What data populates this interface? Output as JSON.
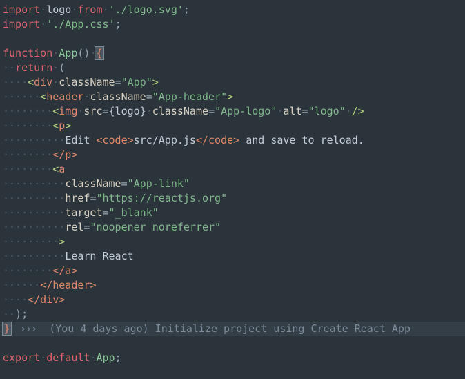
{
  "editor": {
    "background_color": "#2b343b",
    "foreground_color": "#c3ccd4",
    "font_size_px": 15,
    "line_height_px": 21,
    "colors": {
      "keyword": "#e0616e",
      "function_name": "#8cc79a",
      "string": "#7fb78a",
      "jsx_tag": "#e0876a",
      "jsx_bracket": "#b6d07a",
      "attribute": "#d6cfc0",
      "punctuation": "#9aa7b0",
      "indent_guide": "#4d5a63",
      "blame_text": "#7e8b99",
      "blame_background": "#333e47",
      "bracket_highlight_bg": "#4b5861",
      "bracket_highlight_border": "#7d8b94"
    }
  },
  "lines": {
    "l1": {
      "import_kw": "import",
      "binding": "logo",
      "from_kw": "from",
      "module": "'./logo.svg'",
      "semi": ";"
    },
    "l2": {
      "import_kw": "import",
      "module": "'./App.css'",
      "semi": ";"
    },
    "l4": {
      "function_kw": "function",
      "name": "App",
      "parens": "()",
      "brace": "{"
    },
    "l5": {
      "return_kw": "return",
      "paren": "("
    },
    "l6": {
      "open": "<",
      "tag": "div",
      "attr": "className",
      "eq": "=",
      "value": "\"App\"",
      "close": ">"
    },
    "l7": {
      "open": "<",
      "tag": "header",
      "attr": "className",
      "eq": "=",
      "value": "\"App-header\"",
      "close": ">"
    },
    "l8": {
      "open": "<",
      "tag": "img",
      "attr_src": "src",
      "eq1": "=",
      "expr": "{logo}",
      "attr_class": "className",
      "eq2": "=",
      "value_class": "\"App-logo\"",
      "attr_alt": "alt",
      "eq3": "=",
      "value_alt": "\"logo\"",
      "selfclose": "/>"
    },
    "l9": {
      "open": "<",
      "tag": "p",
      "close": ">"
    },
    "l10": {
      "text_before": "Edit ",
      "code_open": "<code>",
      "code_text": "src/App.js",
      "code_close": "</code>",
      "text_after": " and save to reload."
    },
    "l11": {
      "close_tag": "</p>"
    },
    "l12": {
      "open": "<",
      "tag": "a"
    },
    "l13": {
      "attr": "className",
      "eq": "=",
      "value": "\"App-link\""
    },
    "l14": {
      "attr": "href",
      "eq": "=",
      "value": "\"https://reactjs.org\""
    },
    "l15": {
      "attr": "target",
      "eq": "=",
      "value": "\"_blank\""
    },
    "l16": {
      "attr": "rel",
      "eq": "=",
      "value": "\"noopener noreferrer\""
    },
    "l17": {
      "close": ">"
    },
    "l18": {
      "text": "Learn React"
    },
    "l19": {
      "close_tag": "</a>"
    },
    "l20": {
      "close_tag": "</header>"
    },
    "l21": {
      "close_tag": "</div>"
    },
    "l22": {
      "paren": ")",
      "semi": ";"
    },
    "l23_blame": {
      "brace": "}",
      "arrows": "›››",
      "annotation": "(You 4 days ago) Initialize project using Create React App"
    },
    "l25": {
      "export_kw": "export",
      "default_kw": "default",
      "name": "App",
      "semi": ";"
    }
  },
  "indent_guides": {
    "dot": "·",
    "l5": "··",
    "l6": "····",
    "l7": "······",
    "l8": "········",
    "l9": "········",
    "l10": "··········",
    "l11": "········",
    "l12": "········",
    "l13": "··········",
    "l17": "········",
    "l18": "··········",
    "l19": "········",
    "l20": "······",
    "l21": "····",
    "l22": "··"
  },
  "spacers": {
    "sp": " ",
    "i2": "  ",
    "i4": "    ",
    "i6": "      ",
    "i8": "        ",
    "i10": "          ",
    "i12": "            ",
    "i16": "                ",
    "i20": "                    "
  }
}
